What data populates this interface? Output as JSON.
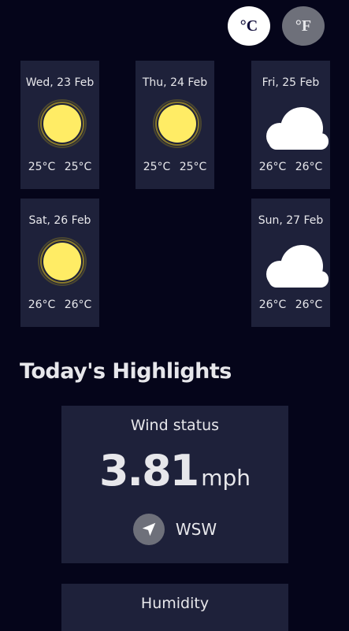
{
  "units": {
    "celsius_label": "°C",
    "fahrenheit_label": "°F"
  },
  "forecast": [
    {
      "date": "Wed, 23 Feb",
      "icon": "sun-icon",
      "temp_max": "25°C",
      "temp_min": "25°C"
    },
    {
      "date": "Thu, 24 Feb",
      "icon": "sun-icon",
      "temp_max": "25°C",
      "temp_min": "25°C"
    },
    {
      "date": "Fri, 25 Feb",
      "icon": "cloud-icon",
      "temp_max": "26°C",
      "temp_min": "26°C"
    },
    {
      "date": "Sat, 26 Feb",
      "icon": "sun-icon",
      "temp_max": "26°C",
      "temp_min": "26°C"
    },
    {
      "date": "Sun, 27 Feb",
      "icon": "cloud-icon",
      "temp_max": "26°C",
      "temp_min": "26°C"
    }
  ],
  "highlights": {
    "title": "Today's Highlights",
    "wind": {
      "title": "Wind status",
      "value": "3.81",
      "unit": "mph",
      "direction": "WSW",
      "icon": "navigation-arrow-icon"
    },
    "humidity": {
      "title": "Humidity"
    }
  },
  "colors": {
    "background": "#05051a",
    "card": "#1e213a",
    "text": "#e7e7eb",
    "sun": "#ffec65",
    "toggle_active": "#ffffff",
    "toggle_inactive": "#6e707a"
  }
}
